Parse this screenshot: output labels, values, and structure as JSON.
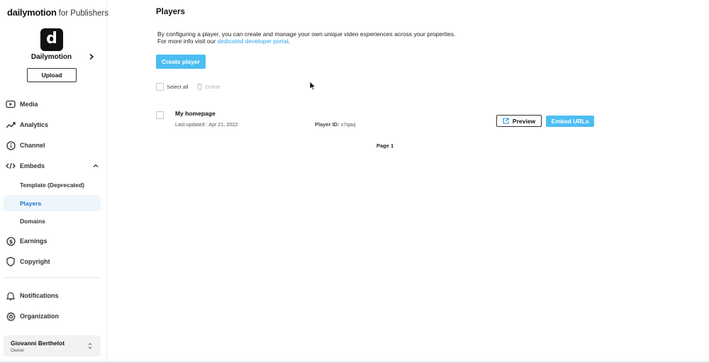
{
  "brand": {
    "logo": "dailymotion",
    "suffix": "for Publishers"
  },
  "channel": {
    "avatar_letter": "d",
    "name": "Dailymotion"
  },
  "sidebar": {
    "upload_label": "Upload",
    "items": [
      {
        "label": "Media",
        "icon": "play-square-icon"
      },
      {
        "label": "Analytics",
        "icon": "trend-up-icon"
      },
      {
        "label": "Channel",
        "icon": "info-circle-icon"
      },
      {
        "label": "Embeds",
        "icon": "code-icon",
        "expanded": true
      },
      {
        "label": "Earnings",
        "icon": "dollar-circle-icon"
      },
      {
        "label": "Copyright",
        "icon": "shield-icon"
      },
      {
        "label": "Notifications",
        "icon": "bell-icon"
      },
      {
        "label": "Organization",
        "icon": "gear-icon"
      }
    ],
    "embeds_sub": [
      {
        "label": "Template (Deprecated)",
        "active": false
      },
      {
        "label": "Players",
        "active": true
      },
      {
        "label": "Domains",
        "active": false
      }
    ],
    "user": {
      "name": "Giovanni Berthelot",
      "role": "Owner"
    }
  },
  "main": {
    "title": "Players",
    "intro_line1": "By configuring a player, you can create and manage your own unique video experiences across your properties.",
    "intro_line2_prefix": "For more info visit our ",
    "intro_link": "dedicated developer portal",
    "intro_line2_suffix": ".",
    "create_button": "Create player",
    "select_all": "Select all",
    "delete": "Delete",
    "players": [
      {
        "name": "My homepage",
        "last_updated": "Last updated : Apr 21, 2022",
        "player_id_label": "Player ID:",
        "player_id": "x7qaq",
        "preview_label": "Preview",
        "embed_label": "Embed URLs"
      }
    ],
    "pagination": "Page 1"
  },
  "colors": {
    "accent": "#4cbdf2",
    "link": "#2fa4e7",
    "active_nav_bg": "#eef5fb",
    "active_nav_text": "#1a73c8"
  }
}
